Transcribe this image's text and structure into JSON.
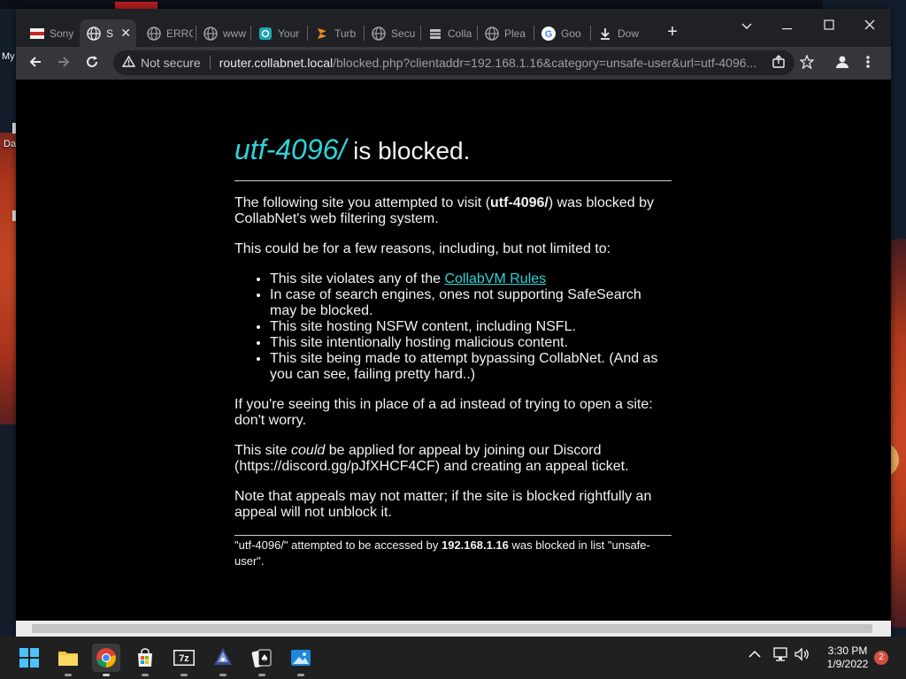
{
  "desktop": {
    "icon_labels": [
      "My",
      "Da"
    ]
  },
  "tabs": [
    {
      "title": "Sony",
      "favicon": "sony-favicon",
      "active": false
    },
    {
      "title": "S",
      "favicon": "globe-icon",
      "active": true
    },
    {
      "title": "ERRO",
      "favicon": "globe-icon",
      "active": false
    },
    {
      "title": "www",
      "favicon": "globe-icon",
      "active": false
    },
    {
      "title": "Your",
      "favicon": "teal-app-icon",
      "active": false
    },
    {
      "title": "Turb",
      "favicon": "turbo-icon",
      "active": false
    },
    {
      "title": "Secu",
      "favicon": "globe-icon",
      "active": false
    },
    {
      "title": "Colla",
      "favicon": "collab-icon",
      "active": false
    },
    {
      "title": "Plea",
      "favicon": "globe-icon",
      "active": false
    },
    {
      "title": "Goo",
      "favicon": "google-icon",
      "active": false
    },
    {
      "title": "Dow",
      "favicon": "download-icon",
      "active": false
    }
  ],
  "address_bar": {
    "security_label": "Not secure",
    "host": "router.collabnet.local",
    "path": "/blocked.php?clientaddr=192.168.1.16&category=unsafe-user&url=utf-4096..."
  },
  "page": {
    "heading_site": "utf-4096/",
    "heading_rest": " is blocked.",
    "intro_pre": "The following site you attempted to visit (",
    "intro_site": "utf-4096/",
    "intro_post": ") was blocked by CollabNet's web filtering system.",
    "reasons_intro": "This could be for a few reasons, including, but not limited to:",
    "reason1_pre": "This site violates any of the ",
    "reason1_link": "CollabVM Rules",
    "reasons": [
      "In case of search engines, ones not supporting SafeSearch may be blocked.",
      "This site hosting NSFW content, including NSFL.",
      "This site intentionally hosting malicious content.",
      "This site being made to attempt bypassing CollabNet. (And as you can see, failing pretty hard..)"
    ],
    "ad_note": "If you're seeing this in place of a ad instead of trying to open a site: don't worry.",
    "appeal_pre": "This site ",
    "appeal_em": "could",
    "appeal_post": " be applied for appeal by joining our Discord (https://discord.gg/pJfXHCF4CF) and creating an appeal ticket.",
    "appeal_note": "Note that appeals may not matter; if the site is blocked rightfully an appeal will not unblock it.",
    "footer_pre": "\"utf-4096/\" attempted to be accessed by ",
    "footer_ip": "192.168.1.16",
    "footer_post": " was blocked in list \"unsafe-user\"."
  },
  "taskbar": {
    "time": "3:30 PM",
    "date": "1/9/2022",
    "notification_count": "2"
  },
  "colors": {
    "link_accent": "#2ed3d8",
    "page_background": "#000000",
    "browser_chrome": "#35363a"
  }
}
